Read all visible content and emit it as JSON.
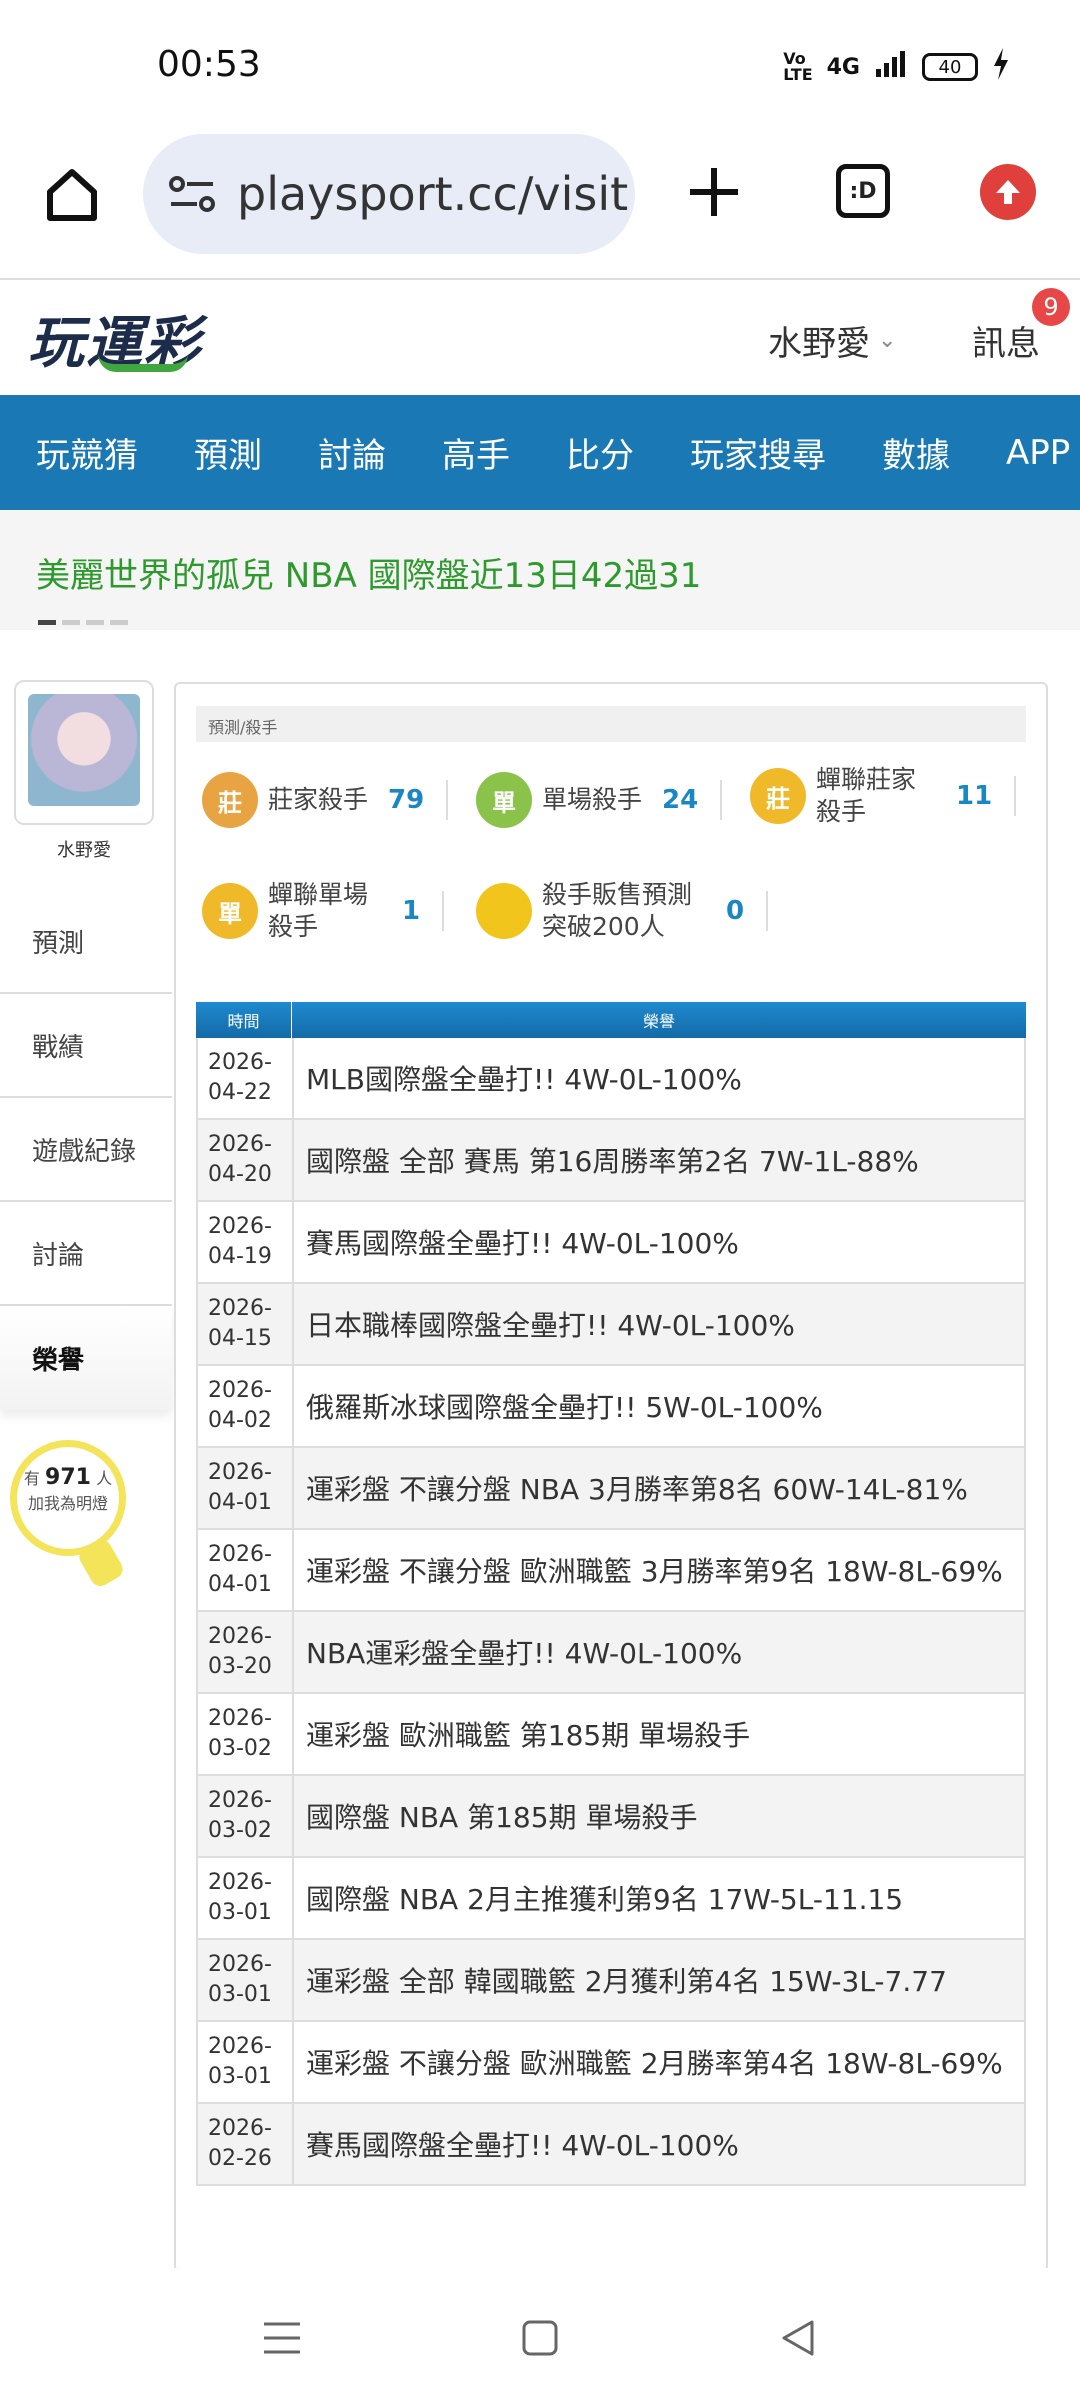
{
  "status": {
    "time": "00:53",
    "network": "4G",
    "battery": "40"
  },
  "browser": {
    "url": "playsport.cc/visit",
    "tabs_label": ":D"
  },
  "site": {
    "logo": "玩運彩",
    "username": "水野愛",
    "messages_label": "訊息",
    "messages_count": "9"
  },
  "nav": {
    "items": [
      "玩競猜",
      "預測",
      "討論",
      "高手",
      "比分",
      "玩家搜尋",
      "數據",
      "APP"
    ]
  },
  "marquee": {
    "text": "美麗世界的孤兒  NBA 國際盤近13日42過31"
  },
  "sidebar": {
    "name": "水野愛",
    "menu": [
      "預測",
      "戰績",
      "遊戲紀錄",
      "討論",
      "榮譽"
    ],
    "fans_prefix": "有",
    "fans_count": "971",
    "fans_suffix": "人",
    "fans_cta": "加我為明燈"
  },
  "panel": {
    "breadcrumb": "預測/殺手",
    "honors": [
      {
        "badge": "莊",
        "label1": "莊家殺手",
        "label2": "",
        "count": "79",
        "color": "#e8a443"
      },
      {
        "badge": "單",
        "label1": "單場殺手",
        "label2": "",
        "count": "24",
        "color": "#8ac24a"
      },
      {
        "badge": "莊",
        "label1": "蟬聯莊家",
        "label2": "殺手",
        "count": "11",
        "color": "#f0b929"
      },
      {
        "badge": "單",
        "label1": "蟬聯單場",
        "label2": "殺手",
        "count": "1",
        "color": "#f0b929"
      },
      {
        "badge": "",
        "label1": "殺手販售預測",
        "label2": "突破200人",
        "count": "0",
        "color": "#f2c51c"
      }
    ],
    "table_headers": {
      "time": "時間",
      "honor": "榮譽"
    },
    "rows": [
      {
        "date1": "2026-",
        "date2": "04-22",
        "text": "MLB國際盤全壘打!! 4W-0L-100%"
      },
      {
        "date1": "2026-",
        "date2": "04-20",
        "text": "國際盤 全部 賽馬 第16周勝率第2名 7W-1L-88%"
      },
      {
        "date1": "2026-",
        "date2": "04-19",
        "text": "賽馬國際盤全壘打!! 4W-0L-100%"
      },
      {
        "date1": "2026-",
        "date2": "04-15",
        "text": "日本職棒國際盤全壘打!! 4W-0L-100%"
      },
      {
        "date1": "2026-",
        "date2": "04-02",
        "text": "俄羅斯冰球國際盤全壘打!! 5W-0L-100%"
      },
      {
        "date1": "2026-",
        "date2": "04-01",
        "text": "運彩盤 不讓分盤 NBA 3月勝率第8名 60W-14L-81%"
      },
      {
        "date1": "2026-",
        "date2": "04-01",
        "text": "運彩盤 不讓分盤 歐洲職籃 3月勝率第9名 18W-8L-69%"
      },
      {
        "date1": "2026-",
        "date2": "03-20",
        "text": "NBA運彩盤全壘打!! 4W-0L-100%"
      },
      {
        "date1": "2026-",
        "date2": "03-02",
        "text": "運彩盤 歐洲職籃 第185期 單場殺手"
      },
      {
        "date1": "2026-",
        "date2": "03-02",
        "text": "國際盤 NBA 第185期 單場殺手"
      },
      {
        "date1": "2026-",
        "date2": "03-01",
        "text": "國際盤 NBA 2月主推獲利第9名 17W-5L-11.15"
      },
      {
        "date1": "2026-",
        "date2": "03-01",
        "text": "運彩盤 全部 韓國職籃 2月獲利第4名 15W-3L-7.77"
      },
      {
        "date1": "2026-",
        "date2": "03-01",
        "text": "運彩盤 不讓分盤 歐洲職籃 2月勝率第4名 18W-8L-69%"
      },
      {
        "date1": "2026-",
        "date2": "02-26",
        "text": "賽馬國際盤全壘打!! 4W-0L-100%"
      }
    ]
  }
}
